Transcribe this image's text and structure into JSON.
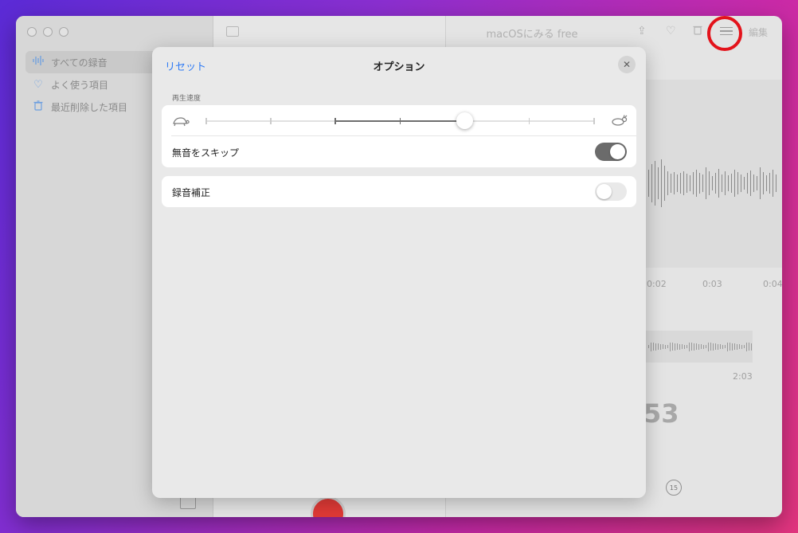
{
  "window": {
    "title": "macOSにみる free",
    "edit_label": "編集"
  },
  "sidebar": {
    "items": [
      {
        "label": "すべての録音",
        "icon": "waveform-icon",
        "selected": true
      },
      {
        "label": "よく使う項目",
        "icon": "heart-icon",
        "selected": false
      },
      {
        "label": "最近削除した項目",
        "icon": "trash-icon",
        "selected": false
      }
    ]
  },
  "detail": {
    "timeline": [
      "0:02",
      "0:03",
      "0:04"
    ],
    "clip_duration": "2:03",
    "current_time_fragment": "53",
    "skip_forward_label": "15"
  },
  "options_modal": {
    "reset_label": "リセット",
    "title": "オプション",
    "close_icon": "close-icon",
    "playback_speed_label": "再生速度",
    "playback_speed": {
      "ticks": 7,
      "selected_index": 4,
      "fill_from_index": 2
    },
    "skip_silence": {
      "label": "無音をスキップ",
      "on": true
    },
    "enhance_recording": {
      "label": "録音補正",
      "on": false
    }
  },
  "colors": {
    "accent": "#2f7bf5",
    "highlight_ring": "#e3131b",
    "record": "#e03a36"
  }
}
